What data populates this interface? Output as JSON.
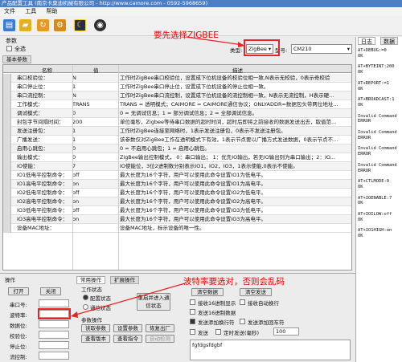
{
  "window": {
    "title": "产品配置工具 (南京卡莫迪机械有限公司 - http://www.camore.com - 0592-5968659)"
  },
  "menu": [
    "文件",
    "工具",
    "帮助"
  ],
  "params": {
    "group_label": "参数",
    "select_all_label": "全选"
  },
  "type_selector": {
    "label": "类型:",
    "value": "ZigBee",
    "model_label": "型号:",
    "model_value": "CM210"
  },
  "tabs": {
    "basic": "基本参数"
  },
  "annotations": {
    "top": "要先选择ZIGBEE",
    "bottom": "波特率要选对，否则会乱码"
  },
  "grid": {
    "columns": [
      "名称",
      "值",
      "描述"
    ],
    "rows": [
      {
        "name": "串口校验位：",
        "value": "N",
        "desc": "工作时ZigBee串口校验位，设置成下位机设备的校验位相一致,N表示无校验，0表示奇校验"
      },
      {
        "name": "串口停止位：",
        "value": "1",
        "desc": "工作时ZigBee串口停止位，设置成下位机设备的停止位相一致。"
      },
      {
        "name": "串口流控制：",
        "value": "N",
        "desc": "工作时ZigBee串口流控制，设置成下位机设备的流控制相一致，N表示无流控制，H表示硬..."
      },
      {
        "name": "工作模式：",
        "value": "TRANS",
        "desc": "TRANS = 透明模式；CAIMORE = CAIMORE通信协议；ONLYADDR=数据包头带两位地址..."
      },
      {
        "name": "调试模式：",
        "value": "0",
        "desc": "0 = 无调试信息；1 = 部分调试信息；2 = 全部调试信息。"
      },
      {
        "name": "封包字节间隔时间：",
        "value": "200",
        "desc": "单位毫秒，Zigbee等待串口数据的超时时间，超时后即将之前接收的数据发送出去，取值范..."
      },
      {
        "name": "发送注册包：",
        "value": "1",
        "desc": "工作时ZigBee连接至网络时，1表示发送注册包，0表示不发送注册包。"
      },
      {
        "name": "广播发送：",
        "value": "1",
        "desc": "该参数仅对ZigBee工作在透明模式下有效，1表示节点要以广播方式发送数据，0表示节点不..."
      },
      {
        "name": "启用心跳包：",
        "value": "0",
        "desc": "0 = 不启用心跳包；1 = 启用心跳包。"
      },
      {
        "name": "输出模式：",
        "value": "0",
        "desc": "ZigBee输出控制模式， 0：串口输出； 1：优先IO输出，若无IO输出则为串口输出；2：IO..."
      },
      {
        "name": "IO使能：",
        "value": "7",
        "desc": "IO使能位，3位2进制数分别表示IO1，IO2，IO3，1表示使能,0表示不使能。"
      },
      {
        "name": "IO1低电平控制命令：",
        "value": "off",
        "desc": "最大长度为16个字符，用户可以使用此命令设置IO1为低电平。"
      },
      {
        "name": "IO1高电平控制命令：",
        "value": "on",
        "desc": "最大长度为16个字符，用户可以使用此命令设置IO1为高电平。"
      },
      {
        "name": "IO2低电平控制命令：",
        "value": "off",
        "desc": "最大长度为16个字符，用户可以使用此命令设置IO2为低电平。"
      },
      {
        "name": "IO2高电平控制命令：",
        "value": "on",
        "desc": "最大长度为16个字符，用户可以使用此命令设置IO2为高电平。"
      },
      {
        "name": "IO3低电平控制命令：",
        "value": "off",
        "desc": "最大长度为16个字符，用户可以使用此命令设置IO3为低电平。"
      },
      {
        "name": "IO3高电平控制命令：",
        "value": "on",
        "desc": "最大长度为16个字符，用户可以使用此命令设置IO3为高电平。"
      },
      {
        "name": "设备MAC地址：",
        "value": "",
        "desc": "设备MAC地址，标示设备的唯一性。"
      }
    ]
  },
  "right_panel": {
    "tabs": [
      "日志",
      "数据"
    ],
    "log": "AT+DEBUG:=0\nOK\n\nAT+BYTEINT:200\nOK\n\nAT+REPORT:=1\nOK\n\nAT+BROADCAST:1\nOK\n\nInvalid Command\nERROR\n\nInvalid Command\nERROR\n\nInvalid Command\nERROR\n\nInvalid Command\nERROR\n\nAT+CTLMODE:0\nOK\n\nAT+IOENABLE:7\nOK\n\nAT+IOILOW:off\nOK\n\nAT+IO1HIGH:on\nOK"
  },
  "bottom": {
    "group_label": "操作",
    "open": "打开",
    "close": "关闭",
    "port_label": "串口号:",
    "baud_label": "波特率:",
    "data_label": "数据位:",
    "parity_label": "校验位:",
    "stop_label": "停止位:",
    "flow_label": "流控制:",
    "tab_common": "常用操作",
    "tab_ext": "扩展操作",
    "work_state": "工作状态",
    "cfg_state": "配置状态",
    "comm_state": "通信状态",
    "restart_btn": "重启并进入通信状态",
    "param_ops": "参数操作",
    "read_btn": "读取参数",
    "set_btn": "设置参数",
    "restore_btn": "恢复出厂",
    "view_version": "查看版本",
    "view_cmd": "查看指令",
    "auto_detect": "自动检测",
    "clear_data": "清空数据",
    "clear_send": "清空发送",
    "hex_display": "接收16进制显示",
    "auto_wrap": "接收自动换行",
    "hex_send": "发送16进制数据",
    "send_newline": "发送添加换行符",
    "send_cr": "发送添加回车符",
    "timed_send": "定时发送(毫秒)",
    "timed_value": "100",
    "send_btn": "发送",
    "send_text": "fgfdgsfdgbf"
  }
}
